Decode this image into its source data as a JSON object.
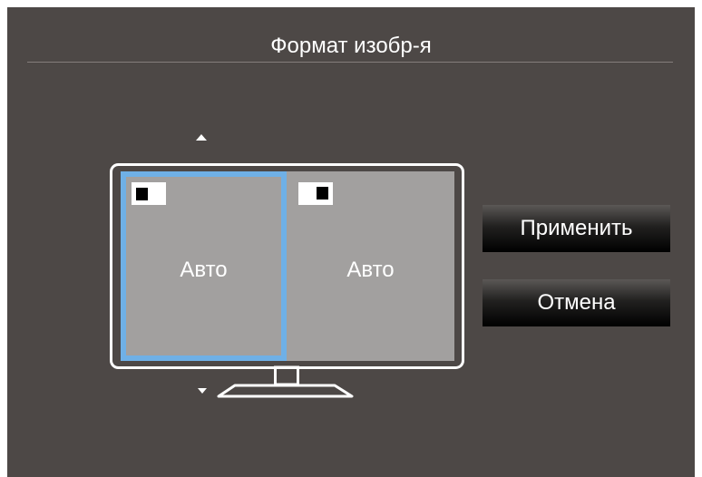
{
  "osd": {
    "title": "Формат изобр-я",
    "colors": {
      "background": "#4d4846",
      "selection": "#6fb0e6",
      "panel": "#a2a09f"
    },
    "picture_size": {
      "options": [
        {
          "label": "Авто",
          "selected": true
        },
        {
          "label": "Авто",
          "selected": false
        }
      ]
    },
    "icons": [
      "arrow-up-icon",
      "arrow-down-icon",
      "monitor-icon",
      "aspect-ratio-icon"
    ],
    "buttons": {
      "apply_label": "Применить",
      "cancel_label": "Отмена"
    }
  }
}
